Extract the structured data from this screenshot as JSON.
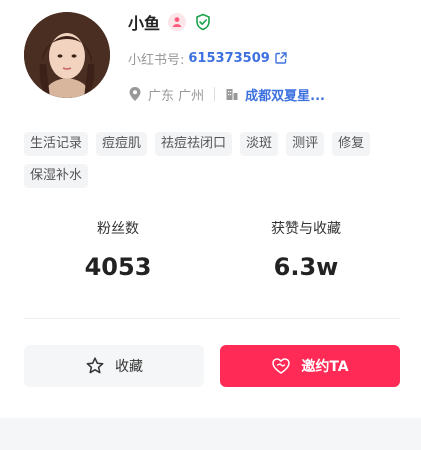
{
  "profile": {
    "name": "小鱼",
    "id_label": "小红书号:",
    "id_value": "615373509",
    "location": "广东 广州",
    "company": "成都双夏星..."
  },
  "tags": [
    "生活记录",
    "痘痘肌",
    "祛痘祛闭口",
    "淡斑",
    "测评",
    "修复",
    "保湿补水"
  ],
  "stats": {
    "fans_label": "粉丝数",
    "fans_value": "4053",
    "likes_label": "获赞与收藏",
    "likes_value": "6.3w"
  },
  "actions": {
    "favorite_label": "收藏",
    "invite_label": "邀约TA"
  },
  "colors": {
    "accent_blue": "#3d71e0",
    "invite_red": "#ff2a55",
    "verified_green": "#1aa34a",
    "female_pink": "#ff5a7a"
  },
  "icons": {
    "gender": "female-icon",
    "verified": "verified-shield-icon",
    "external_link": "external-link-icon",
    "location": "location-pin-icon",
    "company": "building-icon",
    "favorite": "star-outline-icon",
    "invite": "heart-handshake-icon"
  }
}
